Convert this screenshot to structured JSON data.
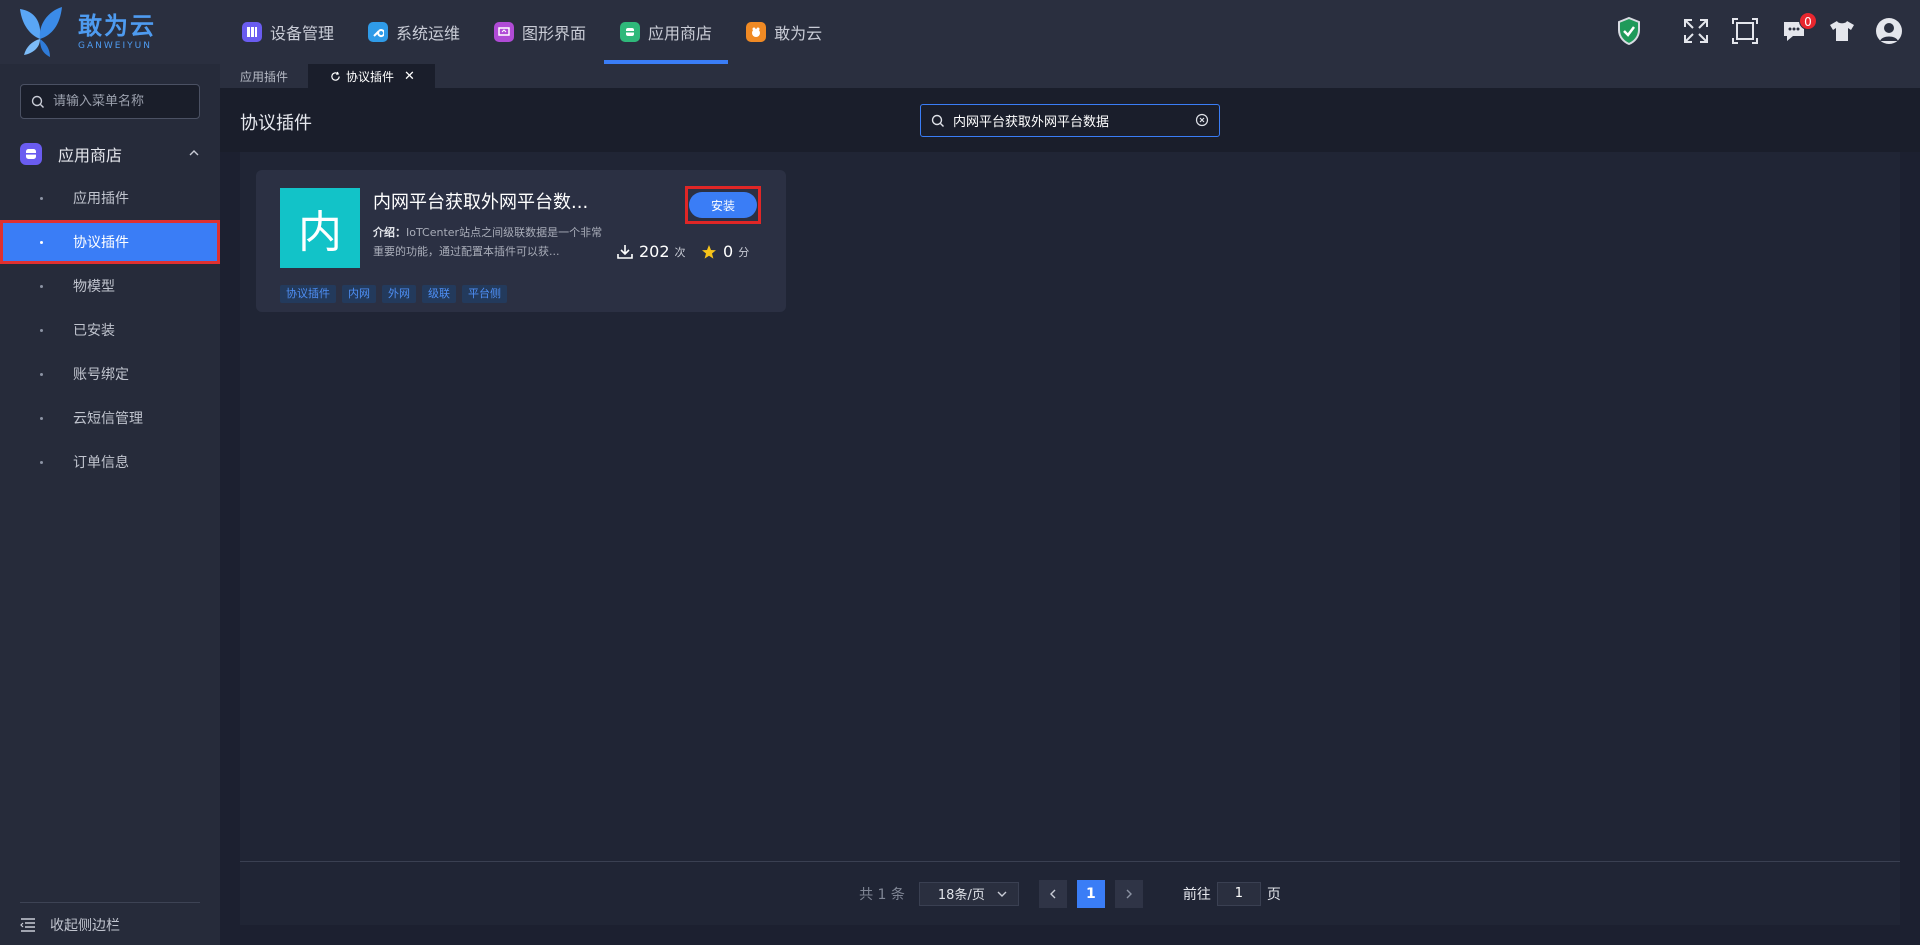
{
  "app": {
    "logo_cn": "敢为云",
    "logo_en": "GANWEIYUN"
  },
  "topnav": [
    {
      "label": "设备管理",
      "color": "#6a5cf0",
      "icon": "device-icon"
    },
    {
      "label": "系统运维",
      "color": "#2f9be8",
      "icon": "wrench-icon"
    },
    {
      "label": "图形界面",
      "color": "#b04bd6",
      "icon": "graphic-icon"
    },
    {
      "label": "应用商店",
      "color": "#2fb87a",
      "icon": "store-icon",
      "active": true
    },
    {
      "label": "敢为云",
      "color": "#f08a24",
      "icon": "cloud-icon"
    }
  ],
  "topright": {
    "notification_count": "0"
  },
  "sidebar": {
    "search_placeholder": "请输入菜单名称",
    "group_label": "应用商店",
    "items": [
      "应用插件",
      "协议插件",
      "物模型",
      "已安装",
      "账号绑定",
      "云短信管理",
      "订单信息"
    ],
    "active_index": 1,
    "collapse_label": "收起侧边栏"
  },
  "tabs": [
    {
      "label": "应用插件"
    },
    {
      "label": "协议插件",
      "active": true
    }
  ],
  "page": {
    "title": "协议插件",
    "search_value": "内网平台获取外网平台数据"
  },
  "card": {
    "logo_char": "内",
    "title": "内网平台获取外网平台数...",
    "desc_label": "介绍：",
    "desc_text": "IoTCenter站点之间级联数据是一个非常重要的功能，通过配置本插件可以获...",
    "downloads": "202",
    "downloads_unit": "次",
    "rating": "0",
    "rating_unit": "分",
    "install_label": "安装",
    "tags": [
      "协议插件",
      "内网",
      "外网",
      "级联",
      "平台侧"
    ]
  },
  "pagination": {
    "total_text": "共 1 条",
    "page_size": "18条/页",
    "current_page": "1",
    "goto_label": "前往",
    "goto_value": "1",
    "page_unit": "页"
  }
}
